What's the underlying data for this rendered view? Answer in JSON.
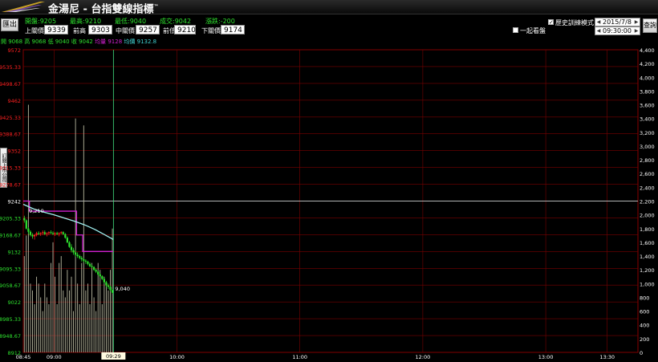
{
  "app": {
    "title": "金湯尼 - 台指雙線指標",
    "trademark": "™"
  },
  "buttons": {
    "exit": "匯出",
    "query": "查詢",
    "side_tab": "訂閱上市公司"
  },
  "stats": {
    "open": "開盤:9205",
    "high": "最高:9210",
    "low": "最低:9040",
    "close": "成交:9042",
    "change": "漲跌:-200"
  },
  "prices": {
    "upper_label": "上關價",
    "upper": "9339",
    "prev_high_label": "前高",
    "prev_high": "9303",
    "middle_label": "中關價",
    "middle": "9257",
    "prev_low_label": "前低",
    "prev_low": "9210",
    "lower_label": "下關價",
    "lower": "9174"
  },
  "options": {
    "history_mode_label": "歷史訓練模式",
    "history_mode_checked": true,
    "sync_view_label": "一起看盤",
    "sync_view_checked": false,
    "date": "2015/7/8",
    "time": "09:30:00"
  },
  "legend": {
    "open": "開 9068",
    "high": "高 9068",
    "low": "低 9040",
    "close": "收 9042",
    "volume": "均量 9128",
    "avg": "均價 9132.8"
  },
  "colors": {
    "red": "#ff2020",
    "green": "#2ee02e",
    "magenta": "#d020d0",
    "cyan": "#a0f0f0",
    "grid": "#7a0000",
    "volume": "#b8b8a0"
  },
  "chart_data": {
    "type": "line",
    "y_left_ticks": [
      "9572",
      "9535.33",
      "9498.67",
      "9462",
      "9425.33",
      "9388.67",
      "9352",
      "9315.33",
      "9278.67",
      "9242",
      "9205.33",
      "9168.67",
      "9132",
      "9095.33",
      "9058.67",
      "9022",
      "8985.33",
      "8948.67",
      "8912"
    ],
    "y_left_range": [
      8912,
      9572
    ],
    "y_right_ticks": [
      "4,400",
      "4,200",
      "4,000",
      "3,800",
      "3,600",
      "3,400",
      "3,200",
      "3,000",
      "2,800",
      "2,600",
      "2,400",
      "2,200",
      "2,000",
      "1,800",
      "1,600",
      "1,400",
      "1,200",
      "1,000",
      "800",
      "600",
      "400",
      "200",
      "0"
    ],
    "y_right_range": [
      0,
      4400
    ],
    "x_ticks": [
      "08:45",
      "09:00",
      "09:29",
      "10:00",
      "11:00",
      "12:00",
      "13:00",
      "13:30"
    ],
    "x_tick_minutes": [
      0,
      15,
      44,
      75,
      135,
      195,
      255,
      285
    ],
    "x_range_minutes": [
      0,
      300
    ],
    "reference_price": 9242,
    "cursor_minute": 44,
    "cursor_label": "09:29",
    "annotations": [
      {
        "text": "9,210",
        "minute": 2,
        "price": 9210
      },
      {
        "text": "9,040",
        "minute": 44,
        "price": 9040
      }
    ],
    "series": [
      {
        "kind": "candlestick",
        "color_up": "#ff2020",
        "color_down": "#2ee02e",
        "ohlc": [
          [
            9205,
            9210,
            9195,
            9200
          ],
          [
            9200,
            9202,
            9180,
            9182
          ],
          [
            9182,
            9185,
            9170,
            9175
          ],
          [
            9175,
            9178,
            9165,
            9168
          ],
          [
            9168,
            9172,
            9160,
            9165
          ],
          [
            9165,
            9170,
            9158,
            9168
          ],
          [
            9168,
            9175,
            9165,
            9172
          ],
          [
            9172,
            9176,
            9168,
            9170
          ],
          [
            9170,
            9174,
            9166,
            9172
          ],
          [
            9172,
            9178,
            9168,
            9174
          ],
          [
            9174,
            9178,
            9168,
            9170
          ],
          [
            9170,
            9174,
            9165,
            9172
          ],
          [
            9172,
            9176,
            9168,
            9174
          ],
          [
            9174,
            9178,
            9170,
            9172
          ],
          [
            9172,
            9176,
            9168,
            9170
          ],
          [
            9170,
            9174,
            9166,
            9172
          ],
          [
            9172,
            9175,
            9168,
            9170
          ],
          [
            9170,
            9174,
            9165,
            9172
          ],
          [
            9172,
            9176,
            9170,
            9174
          ],
          [
            9174,
            9176,
            9168,
            9170
          ],
          [
            9170,
            9172,
            9160,
            9162
          ],
          [
            9162,
            9165,
            9150,
            9152
          ],
          [
            9152,
            9155,
            9140,
            9142
          ],
          [
            9142,
            9148,
            9130,
            9135
          ],
          [
            9135,
            9140,
            9125,
            9130
          ],
          [
            9130,
            9135,
            9120,
            9125
          ],
          [
            9125,
            9130,
            9118,
            9122
          ],
          [
            9122,
            9125,
            9115,
            9118
          ],
          [
            9118,
            9122,
            9110,
            9115
          ],
          [
            9115,
            9118,
            9108,
            9112
          ],
          [
            9112,
            9115,
            9105,
            9110
          ],
          [
            9110,
            9112,
            9102,
            9105
          ],
          [
            9105,
            9108,
            9098,
            9100
          ],
          [
            9100,
            9104,
            9095,
            9098
          ],
          [
            9098,
            9100,
            9090,
            9092
          ],
          [
            9092,
            9095,
            9085,
            9088
          ],
          [
            9088,
            9090,
            9080,
            9082
          ],
          [
            9082,
            9085,
            9075,
            9078
          ],
          [
            9078,
            9080,
            9070,
            9072
          ],
          [
            9072,
            9075,
            9062,
            9065
          ],
          [
            9065,
            9068,
            9055,
            9058
          ],
          [
            9058,
            9062,
            9050,
            9055
          ],
          [
            9055,
            9058,
            9045,
            9048
          ],
          [
            9048,
            9050,
            9040,
            9042
          ]
        ]
      },
      {
        "kind": "step",
        "color": "#d020d0",
        "points": [
          [
            0,
            9242
          ],
          [
            3,
            9242
          ],
          [
            3,
            9220
          ],
          [
            26,
            9220
          ],
          [
            26,
            9168
          ],
          [
            29,
            9168
          ],
          [
            29,
            9132
          ],
          [
            44,
            9132
          ]
        ]
      },
      {
        "kind": "line",
        "color": "#a0f0f0",
        "points": [
          [
            0,
            9235
          ],
          [
            5,
            9225
          ],
          [
            10,
            9218
          ],
          [
            15,
            9212
          ],
          [
            20,
            9205
          ],
          [
            25,
            9198
          ],
          [
            30,
            9190
          ],
          [
            35,
            9180
          ],
          [
            40,
            9168
          ],
          [
            44,
            9158
          ]
        ]
      },
      {
        "kind": "volume",
        "color": "#b8b8a0",
        "values": [
          1400,
          1700,
          3600,
          1000,
          900,
          700,
          1100,
          1000,
          800,
          600,
          1000,
          800,
          700,
          1300,
          1600,
          1100,
          700,
          1300,
          1400,
          900,
          800,
          1200,
          900,
          1100,
          600,
          3400,
          1000,
          700,
          1300,
          3300,
          900,
          1000,
          700,
          1300,
          800,
          600,
          1300,
          1200,
          700,
          1100,
          1000,
          900,
          1200,
          1800
        ]
      }
    ]
  }
}
